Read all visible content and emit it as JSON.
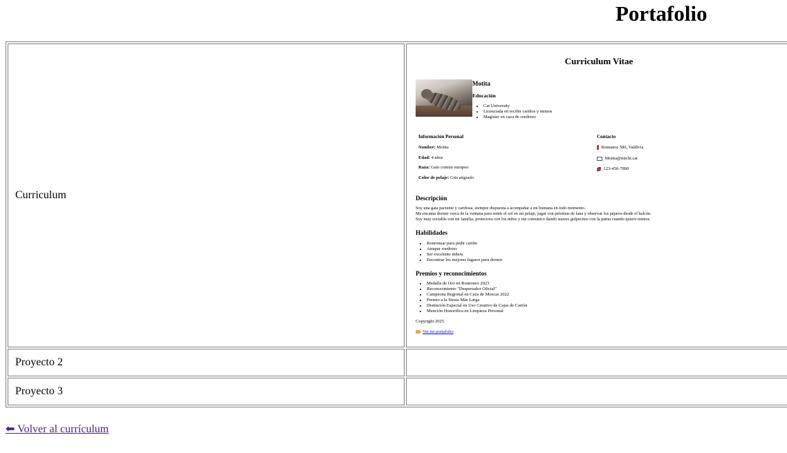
{
  "page": {
    "title": "Portafolio"
  },
  "rows": [
    {
      "label": "Curriculum"
    },
    {
      "label": "Proyecto 2"
    },
    {
      "label": "Proyecto 3"
    }
  ],
  "cv": {
    "title": "Curriculum Vitae",
    "name": "Motita",
    "education": {
      "title": "Educación",
      "items": [
        "Cat University",
        "Licenciada en recibir cariños y mimos",
        "Magister en caza de roedores"
      ]
    },
    "personal": {
      "title": "Información Personal",
      "name_label": "Nombre:",
      "name_value": "Motita",
      "age_label": "Edad:",
      "age_value": "4 años",
      "breed_label": "Raza:",
      "breed_value": "Gato común europeo",
      "color_label": "Color de pelaje:",
      "color_value": "Gris atigrado"
    },
    "contact": {
      "title": "Contacto",
      "address": "Romance 580, Valdivia",
      "email": "Motita@michi.cat",
      "phone": "123-456-7890"
    },
    "description": {
      "title": "Descripción",
      "lines": [
        "Soy una gata paciente y cariñosa, siempre dispuesta a acompañar a mi humana en todo momento.",
        "Me encanta dormir cerca de la ventana para sentir el sol en mi pelaje, jugar con pelotitas de lana y observar los pájaros desde el balcón.",
        "Soy muy sociable con mi familia, protectora con los niños y me comunico dando suaves golpecitos con la patita cuando quiero mimos."
      ]
    },
    "skills": {
      "title": "Habilidades",
      "items": [
        "Ronronear para pedir cariño",
        "Atrapar roedores",
        "Ser excelente niñera",
        "Encontrar los mejores lugares para dormir"
      ]
    },
    "awards": {
      "title": "Premios y reconocimientos",
      "items": [
        "Medalla de Oro en Ronroneo 2023",
        "Reconocimiento \"Despertador Oficial\"",
        "Campeona Regional en Caza de Moscas 2022",
        "Premio a la Siesta Más Larga",
        "Distinción Especial en Uso Creativo de Cajas de Cartón",
        "Mención Honorífica en Limpieza Personal"
      ]
    },
    "copyright": "Copyright 2025",
    "portfolio_link": "Ver mi portafolio"
  },
  "back_link": "⬅ Volver al currículum",
  "icons": {
    "address": "pin-icon",
    "email": "mail-icon",
    "phone": "phone-icon",
    "link": "folder-icon"
  }
}
